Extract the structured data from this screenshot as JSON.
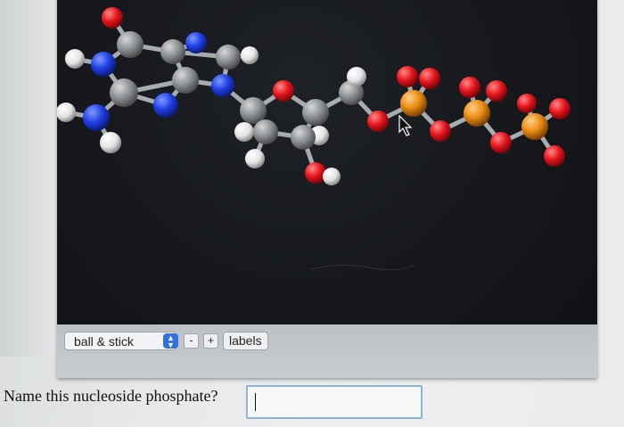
{
  "viewer": {
    "render_mode": "ball & stick",
    "zoom_out_label": "-",
    "zoom_in_label": "+",
    "labels_button": "labels",
    "colors": {
      "carbon": "#8e9193",
      "nitrogen": "#1f3fe6",
      "oxygen": "#e5141c",
      "phosphorus": "#e88a10",
      "hydrogen": "#e8e8e8",
      "background": "#15171b"
    }
  },
  "question": {
    "text": "Name this nucleoside phosphate?",
    "answer_value": ""
  }
}
